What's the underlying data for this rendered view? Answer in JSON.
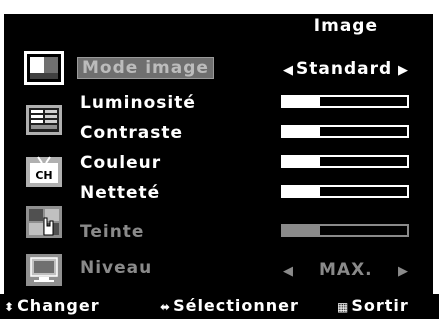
{
  "header": {
    "title": "Image"
  },
  "menu": [
    {
      "id": "mode",
      "label": "Mode image",
      "icon": "picture-icon",
      "type": "select",
      "value": "Standard",
      "selected": true,
      "enabled": true
    },
    {
      "id": "luminosite",
      "label": "Luminosité",
      "icon": "brightness-icon",
      "type": "slider",
      "level": 0.3,
      "enabled": true
    },
    {
      "id": "contraste",
      "label": "Contraste",
      "type": "slider",
      "level": 0.3,
      "enabled": true
    },
    {
      "id": "couleur",
      "label": "Couleur",
      "icon": "tv-channel-icon",
      "type": "slider",
      "level": 0.3,
      "enabled": true
    },
    {
      "id": "nettete",
      "label": "Netteté",
      "type": "slider",
      "level": 0.3,
      "enabled": true
    },
    {
      "id": "teinte",
      "label": "Teinte",
      "icon": "hand-setup-icon",
      "type": "slider",
      "level": 0.3,
      "enabled": false
    },
    {
      "id": "niveau",
      "label": "Niveau",
      "icon": "monitor-icon",
      "type": "select",
      "value": "MAX.",
      "enabled": false
    }
  ],
  "footer": {
    "change_label": "Changer",
    "select_label": "Sélectionner",
    "exit_label": "Sortir",
    "change_symbol": "⬍",
    "select_symbol": "⬌",
    "exit_symbol": "▦"
  },
  "arrows": {
    "left": "◀",
    "right": "▶"
  },
  "colors": {
    "background": "#000000",
    "text": "#ffffff",
    "disabled": "#8a8a8a",
    "highlight": "#6f6f6f"
  }
}
